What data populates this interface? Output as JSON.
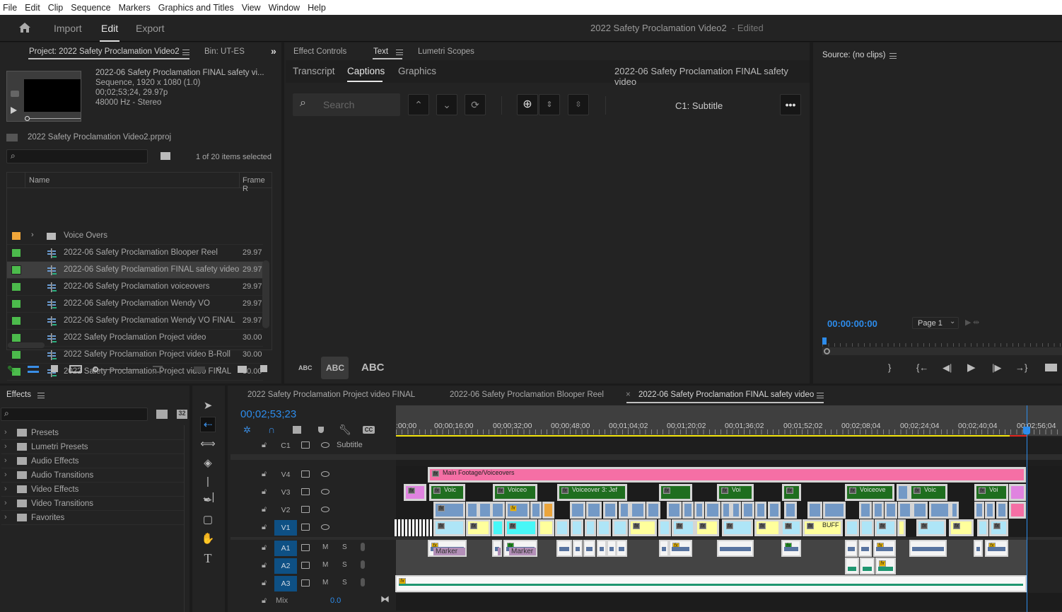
{
  "menubar": [
    "File",
    "Edit",
    "Clip",
    "Sequence",
    "Markers",
    "Graphics and Titles",
    "View",
    "Window",
    "Help"
  ],
  "header": {
    "workspaces": [
      "Import",
      "Edit",
      "Export"
    ],
    "active_workspace": "Edit",
    "document_title": "2022 Safety Proclamation  Video2",
    "edited_suffix": "- Edited"
  },
  "project_panel": {
    "tab_label": "Project: 2022 Safety Proclamation Video2",
    "bin_tab_label": "Bin: UT-ES",
    "preview": {
      "name": "2022-06 Safety Proclamation FINAL safety vi...",
      "details": "Sequence, 1920 x 1080 (1.0)",
      "duration": "00;02;53;24, 29.97p",
      "audio": "48000 Hz - Stereo"
    },
    "project_file": "2022 Safety Proclamation Video2.prproj",
    "search_placeholder": "",
    "selection_status": "1 of 20 items selected",
    "columns": [
      "Name",
      "Frame R"
    ],
    "items": [
      {
        "name": "Voice Overs",
        "type": "folder",
        "frame_rate": "",
        "color": "#f0a63a",
        "selected": false
      },
      {
        "name": "2022-06 Safety Proclamation Blooper Reel",
        "type": "sequence",
        "frame_rate": "29.97",
        "color": "#4cbb4c",
        "selected": false
      },
      {
        "name": "2022-06 Safety Proclamation FINAL safety video",
        "type": "sequence",
        "frame_rate": "29.97",
        "color": "#4cbb4c",
        "selected": true
      },
      {
        "name": "2022-06 Safety Proclamation voiceovers",
        "type": "sequence",
        "frame_rate": "29.97",
        "color": "#4cbb4c",
        "selected": false
      },
      {
        "name": "2022-06 Safety Proclamation Wendy VO",
        "type": "sequence",
        "frame_rate": "29.97",
        "color": "#4cbb4c",
        "selected": false
      },
      {
        "name": "2022-06 Safety Proclamation Wendy VO FINAL",
        "type": "sequence",
        "frame_rate": "29.97",
        "color": "#4cbb4c",
        "selected": false
      },
      {
        "name": "2022 Safety Proclamation Project video",
        "type": "sequence",
        "frame_rate": "30.00",
        "color": "#4cbb4c",
        "selected": false
      },
      {
        "name": "2022 Safety Proclamation Project video B-Roll",
        "type": "sequence",
        "frame_rate": "30.00",
        "color": "#4cbb4c",
        "selected": false
      },
      {
        "name": "2022 Safety Proclamation Project video FINAL",
        "type": "sequence",
        "frame_rate": "30.00",
        "color": "#4cbb4c",
        "selected": false
      }
    ]
  },
  "text_panel": {
    "tabs": [
      "Effect Controls",
      "Text",
      "Lumetri Scopes"
    ],
    "active_tab": "Text",
    "subtabs": [
      "Transcript",
      "Captions",
      "Graphics"
    ],
    "active_subtab": "Captions",
    "sequence_name": "2022-06 Safety Proclamation FINAL safety video",
    "search_placeholder": "Search",
    "track_label": "C1: Subtitle",
    "text_sizes": [
      "ABC",
      "ABC",
      "ABC"
    ],
    "active_text_size": 1
  },
  "source_panel": {
    "title": "Source: (no clips)",
    "timecode": "00:00:00:00",
    "page_select": "Page 1"
  },
  "effects_panel": {
    "title": "Effects",
    "search_placeholder": "",
    "items": [
      "Presets",
      "Lumetri Presets",
      "Audio Effects",
      "Audio Transitions",
      "Video Effects",
      "Video Transitions",
      "Favorites"
    ]
  },
  "tools": [
    "selection",
    "track-select-backward",
    "ripple-edit",
    "razor",
    "slip",
    "pen",
    "rectangle",
    "hand",
    "type"
  ],
  "timeline": {
    "tabs": [
      {
        "label": "2022 Safety Proclamation Project video FINAL",
        "active": false
      },
      {
        "label": "2022-06 Safety Proclamation Blooper Reel",
        "active": false
      },
      {
        "label": "2022-06 Safety Proclamation FINAL safety video",
        "active": true
      }
    ],
    "close_glyph": "×",
    "playhead_timecode": "00;02;53;23",
    "ruler_labels": [
      ":00;00",
      "00;00;16;00",
      "00;00;32;00",
      "00;00;48;00",
      "00;01;04;02",
      "00;01;20;02",
      "00;01;36;02",
      "00;01;52;02",
      "00;02;08;04",
      "00;02;24;04",
      "00;02;40;04",
      "00;02;56;04"
    ],
    "caption_track": {
      "name": "C1",
      "label": "Subtitle"
    },
    "video_tracks": [
      "V4",
      "V3",
      "V2",
      "V1"
    ],
    "audio_tracks": [
      "A1",
      "A2",
      "A3"
    ],
    "mix": {
      "label": "Mix",
      "value": "0.0"
    },
    "mute_label": "M",
    "solo_label": "S",
    "clip_labels": {
      "v4_main": "Main Footage/Voiceovers",
      "v3": [
        "Voic",
        "Voiceo",
        "Voiceover 3: Jef",
        "Voi",
        "Voiceove",
        "Voic",
        "Voi"
      ],
      "v1_buff": "BUFF",
      "a1_marker": "Marker",
      "a1_marker_short": "Ma"
    },
    "fx_glyph": "fx",
    "colors": {
      "pink": "#f56fa5",
      "green": "#1f6e1f",
      "blue": "#7399c6",
      "yellow": "#ffff9c",
      "cyan": "#aee5f7",
      "orange": "#eba53c",
      "violet": "#e083e0",
      "marker": "#b38fb8",
      "audio_green": "#1f9670",
      "playhead": "#2d8ceb",
      "timecode": "#2d8ceb"
    }
  }
}
